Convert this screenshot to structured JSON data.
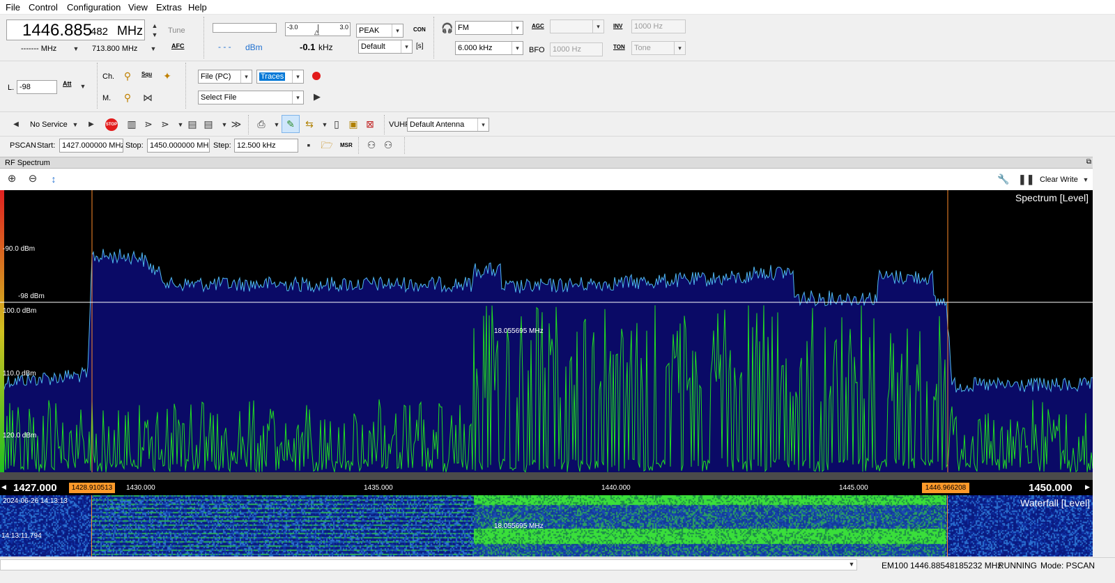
{
  "menu": [
    "File",
    "Control",
    "Configuration",
    "View",
    "Extras",
    "Help"
  ],
  "freq": {
    "main_big": "1446.885",
    "main_small": "482",
    "unit": "MHz",
    "tune_label": "Tune",
    "afc_label": "AFC",
    "sub_freq": "------- MHz",
    "sub_freq2": "713.800  MHz"
  },
  "level": {
    "value": "- - -",
    "unit": "dBm",
    "scale_min": "-3.0",
    "scale_max": "3.0",
    "offset": "-0.1",
    "offset_unit": "kHz"
  },
  "detector": {
    "mode": "PEAK",
    "mode2": "Default",
    "con_label": "CON",
    "s_label": "[s]"
  },
  "demod": {
    "mode": "FM",
    "bandwidth": "6.000 kHz",
    "agc_label": "AGC",
    "agc_value": "",
    "bfo_label": "BFO",
    "bfo_value": "1000 Hz",
    "inv_label": "INV",
    "inv_value": "1000 Hz",
    "ton_label": "TON",
    "ton_value": "Tone"
  },
  "row2": {
    "l_label": "L.",
    "l_value": "-98",
    "att_label": "Att",
    "ch_label": "Ch.",
    "m_label": "M.",
    "squ_label": "Squ",
    "source": "File (PC)",
    "traces": "Traces",
    "select_file": "Select File"
  },
  "row3": {
    "service": "No Service",
    "antenna_label": "VUHF",
    "antenna": "Default Antenna"
  },
  "pscan": {
    "label": "PSCAN",
    "start_label": "Start:",
    "start_value": "1427.000000 MHz",
    "stop_label": "Stop:",
    "stop_value": "1450.000000 MHz",
    "step_label": "Step:",
    "step_value": "12.500 kHz",
    "msr_label": "MSR"
  },
  "rf": {
    "title": "RF Spectrum",
    "clear_write": "Clear Write",
    "spectrum_title": "Spectrum [Level]",
    "waterfall_title": "Waterfall [Level]",
    "y_labels": [
      "-90.0 dBm",
      "-98 dBm",
      "100.0 dBm",
      "110.0 dBm",
      "120.0 dBm"
    ],
    "bw_label": "18.055695 MHz",
    "freq_start": "1427.000",
    "freq_end": "1450.000",
    "marker_left": "1428.910513",
    "marker_right": "1446.966208",
    "ticks": [
      "1430.000",
      "1435.000",
      "1440.000",
      "1445.000"
    ],
    "wf_time_top": "2024-06-26 14:13:13",
    "wf_time_bottom": "14:13:11.794",
    "wf_bw_label": "18.055695 MHz"
  },
  "status": {
    "device": "EM100",
    "freq": "1446.88548185232 MHz",
    "state": "RUNNING",
    "mode": "Mode: PSCAN"
  },
  "colors": {
    "spectrum_fill": "#0a0a66",
    "trace_blue": "#4fb8f0",
    "trace_green": "#22dd22",
    "marker": "#ff8c2a"
  }
}
